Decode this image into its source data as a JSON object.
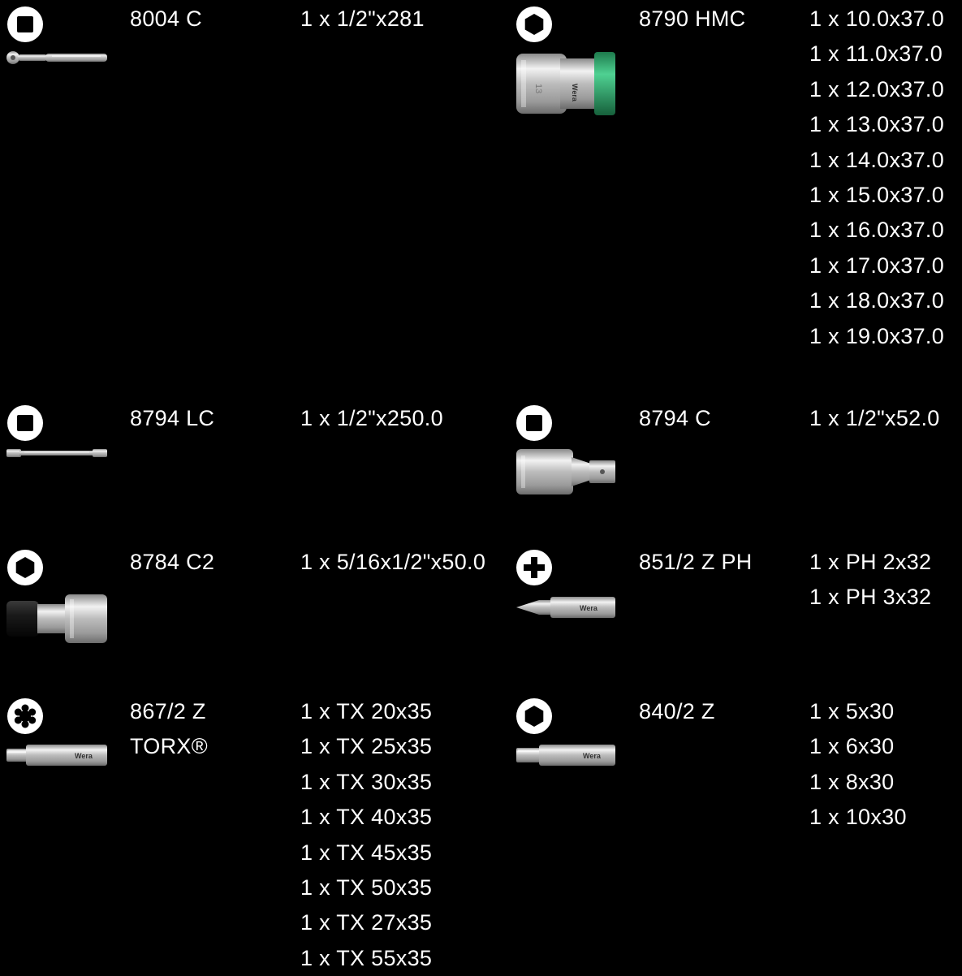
{
  "items": [
    {
      "id": "8004c",
      "drive_icon": "square-drive-icon",
      "tool_image": "ratchet-image",
      "product_lines": [
        "8004 C"
      ],
      "specs": [
        "1 x 1/2\"x281"
      ]
    },
    {
      "id": "8790hmc",
      "drive_icon": "hexagon-drive-icon",
      "tool_image": "hex-socket-image",
      "product_lines": [
        "8790 HMC"
      ],
      "specs": [
        "1 x 10.0x37.0",
        "1 x 11.0x37.0",
        "1 x 12.0x37.0",
        "1 x 13.0x37.0",
        "1 x 14.0x37.0",
        "1 x 15.0x37.0",
        "1 x 16.0x37.0",
        "1 x 17.0x37.0",
        "1 x 18.0x37.0",
        "1 x 19.0x37.0"
      ]
    },
    {
      "id": "8794lc",
      "drive_icon": "square-drive-icon",
      "tool_image": "extension-bar-image",
      "product_lines": [
        "8794 LC"
      ],
      "specs": [
        "1 x 1/2\"x250.0"
      ]
    },
    {
      "id": "8794c",
      "drive_icon": "square-drive-icon",
      "tool_image": "short-extension-image",
      "product_lines": [
        "8794 C"
      ],
      "specs": [
        "1 x 1/2\"x52.0"
      ]
    },
    {
      "id": "8784c2",
      "drive_icon": "hexagon-drive-icon",
      "tool_image": "bit-adaptor-image",
      "product_lines": [
        "8784 C2"
      ],
      "specs": [
        "1 x 5/16x1/2\"x50.0"
      ]
    },
    {
      "id": "851-2zph",
      "drive_icon": "phillips-drive-icon",
      "tool_image": "phillips-bit-image",
      "product_lines": [
        "851/2 Z PH"
      ],
      "specs": [
        "1 x PH 2x32",
        "1 x PH 3x32"
      ]
    },
    {
      "id": "867-2z",
      "drive_icon": "torx-drive-icon",
      "tool_image": "torx-bit-image",
      "product_lines": [
        "867/2 Z",
        "TORX®"
      ],
      "specs": [
        "1 x TX 20x35",
        "1 x TX 25x35",
        "1 x TX 30x35",
        "1 x TX 40x35",
        "1 x TX 45x35",
        "1 x TX 50x35",
        "1 x TX 27x35",
        "1 x TX 55x35"
      ]
    },
    {
      "id": "840-2z",
      "drive_icon": "hexagon-drive-icon",
      "tool_image": "hex-bit-image",
      "product_lines": [
        "840/2 Z"
      ],
      "specs": [
        "1 x 5x30",
        "1 x 6x30",
        "1 x 8x30",
        "1 x 10x30"
      ]
    }
  ],
  "socket_size_label": "13",
  "brand_mark": "Wera",
  "colors": {
    "background": "#000000",
    "text": "#ffffff",
    "icon_fill": "#ffffff",
    "icon_glyph": "#000000",
    "chrome": "#c8c8c8",
    "accent_green": "#2fa06a"
  }
}
